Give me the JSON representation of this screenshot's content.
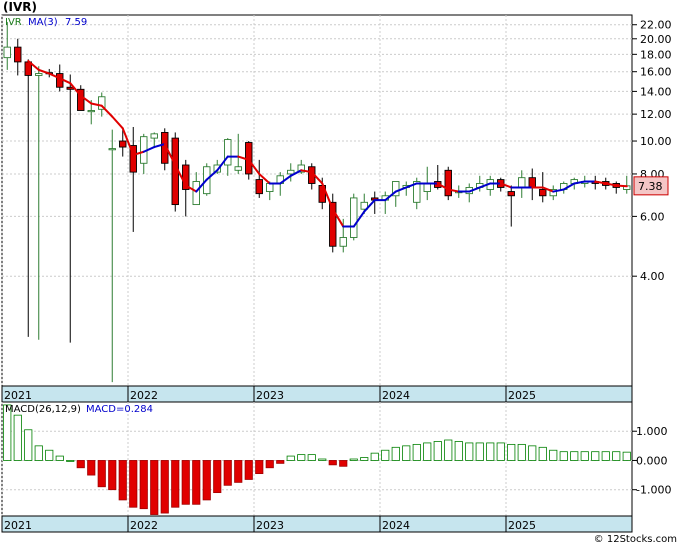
{
  "title": "(IVR)",
  "footer": "© 12Stocks.com",
  "colors": {
    "up": "#2e7d32",
    "down": "#e00000",
    "ma": "#e00000",
    "ma_up": "#0000cc",
    "axis_band": "#c6e5ee",
    "grid": "#cccccc",
    "macd": "#008000"
  },
  "chart_data": [
    {
      "type": "candlestick",
      "legend": {
        "symbol": "IVR",
        "ma_label": "MA(3)",
        "ma_value": "7.59"
      },
      "last_price": "7.38",
      "y_scale": "log",
      "ylim": [
        1.9,
        23.5
      ],
      "y_ticks": [
        "22.00",
        "20.00",
        "18.00",
        "16.00",
        "14.00",
        "12.00",
        "10.00",
        "8.00",
        "6.00",
        "4.00"
      ],
      "x_labels": [
        "2021",
        "2022",
        "2023",
        "2024",
        "2025"
      ],
      "months": [
        "2021-01",
        "2021-02",
        "2021-03",
        "2021-04",
        "2021-05",
        "2021-06",
        "2021-07",
        "2021-08",
        "2021-09",
        "2021-10",
        "2021-11",
        "2021-12",
        "2022-01",
        "2022-02",
        "2022-03",
        "2022-04",
        "2022-05",
        "2022-06",
        "2022-07",
        "2022-08",
        "2022-09",
        "2022-10",
        "2022-11",
        "2022-12",
        "2023-01",
        "2023-02",
        "2023-03",
        "2023-04",
        "2023-05",
        "2023-06",
        "2023-07",
        "2023-08",
        "2023-09",
        "2023-10",
        "2023-11",
        "2023-12",
        "2024-01",
        "2024-02",
        "2024-03",
        "2024-04",
        "2024-05",
        "2024-06",
        "2024-07",
        "2024-08",
        "2024-09",
        "2024-10",
        "2024-11",
        "2024-12",
        "2025-01",
        "2025-02",
        "2025-03",
        "2025-04",
        "2025-05",
        "2025-06",
        "2025-07",
        "2025-08",
        "2025-09",
        "2025-10",
        "2025-11",
        "2025-12"
      ],
      "open": [
        17.6,
        18.9,
        17.1,
        15.6,
        15.9,
        15.8,
        14.4,
        14.2,
        12.3,
        12.4,
        9.5,
        10.0,
        9.7,
        8.6,
        10.2,
        10.6,
        10.2,
        8.5,
        6.5,
        7.0,
        8.1,
        8.5,
        8.2,
        9.9,
        7.7,
        7.1,
        7.5,
        8.0,
        8.1,
        8.4,
        7.4,
        6.6,
        4.9,
        5.2,
        6.3,
        6.8,
        6.7,
        6.9,
        7.3,
        6.6,
        7.1,
        7.6,
        8.2,
        7.1,
        7.0,
        7.3,
        7.2,
        7.7,
        7.1,
        7.3,
        7.8,
        7.2,
        6.9,
        7.2,
        7.5,
        7.5,
        7.6,
        7.6,
        7.5,
        7.2
      ],
      "close": [
        18.9,
        17.1,
        15.6,
        15.8,
        15.8,
        14.4,
        14.2,
        12.3,
        12.3,
        13.5,
        9.5,
        9.6,
        8.1,
        10.3,
        10.5,
        8.6,
        6.5,
        7.2,
        7.6,
        8.4,
        8.5,
        10.1,
        8.4,
        8.0,
        7.0,
        7.5,
        7.9,
        8.2,
        8.5,
        7.5,
        6.6,
        4.9,
        5.2,
        6.8,
        6.6,
        6.7,
        6.9,
        7.6,
        7.4,
        7.6,
        7.5,
        7.3,
        6.9,
        7.1,
        7.3,
        7.5,
        7.7,
        7.3,
        6.9,
        7.8,
        7.3,
        6.9,
        7.2,
        7.5,
        7.7,
        7.6,
        7.5,
        7.4,
        7.3,
        7.38
      ],
      "high": [
        22.4,
        20.0,
        17.4,
        16.6,
        16.3,
        16.8,
        15.7,
        14.6,
        13.2,
        13.9,
        10.8,
        10.8,
        11.0,
        10.5,
        10.6,
        10.9,
        10.6,
        8.8,
        8.1,
        8.6,
        8.8,
        10.2,
        10.5,
        10.0,
        8.8,
        7.6,
        8.1,
        8.6,
        8.8,
        8.6,
        7.8,
        7.0,
        5.9,
        7.0,
        7.0,
        7.1,
        7.1,
        7.6,
        7.6,
        7.8,
        8.4,
        8.5,
        8.4,
        7.4,
        7.5,
        7.9,
        7.9,
        7.8,
        7.4,
        8.2,
        8.3,
        8.1,
        7.4,
        7.6,
        7.8,
        7.9,
        7.9,
        7.8,
        7.6,
        7.9
      ],
      "low": [
        16.2,
        15.6,
        2.65,
        2.6,
        15.4,
        14.0,
        2.55,
        13.3,
        11.2,
        11.8,
        1.95,
        9.0,
        5.4,
        8.0,
        9.6,
        8.2,
        6.2,
        6.0,
        7.1,
        6.9,
        8.0,
        7.9,
        8.0,
        7.7,
        6.8,
        6.7,
        6.9,
        7.6,
        8.0,
        7.2,
        6.3,
        4.7,
        4.7,
        5.1,
        6.1,
        6.1,
        6.1,
        6.4,
        6.9,
        6.3,
        6.7,
        7.2,
        6.7,
        6.8,
        6.6,
        7.1,
        6.9,
        7.1,
        5.6,
        6.8,
        6.7,
        6.6,
        6.7,
        7.0,
        7.2,
        7.3,
        7.2,
        7.2,
        7.0,
        7.0
      ],
      "ma": [
        null,
        null,
        17.2,
        16.2,
        15.8,
        15.3,
        14.8,
        13.6,
        12.9,
        12.7,
        11.8,
        10.9,
        9.1,
        9.3,
        9.6,
        9.8,
        8.5,
        7.4,
        7.1,
        7.7,
        8.2,
        9.0,
        9.0,
        8.8,
        8.0,
        7.5,
        7.5,
        7.9,
        8.2,
        8.1,
        7.5,
        6.3,
        5.6,
        5.6,
        6.2,
        6.7,
        6.7,
        7.1,
        7.3,
        7.5,
        7.5,
        7.5,
        7.2,
        7.1,
        7.1,
        7.3,
        7.5,
        7.5,
        7.3,
        7.3,
        7.3,
        7.3,
        7.1,
        7.2,
        7.5,
        7.6,
        7.6,
        7.5,
        7.4,
        7.36
      ],
      "ma_trend": [
        "up",
        "up",
        "down",
        "down",
        "down",
        "down",
        "down",
        "down",
        "down",
        "down",
        "down",
        "down",
        "down",
        "down",
        "up",
        "up",
        "down",
        "down",
        "down",
        "up",
        "up",
        "up",
        "up",
        "down",
        "down",
        "down",
        "up",
        "up",
        "up",
        "down",
        "down",
        "down",
        "down",
        "up",
        "up",
        "up",
        "up",
        "up",
        "up",
        "up",
        "up",
        "up",
        "down",
        "down",
        "up",
        "up",
        "up",
        "up",
        "down",
        "up",
        "up",
        "down",
        "down",
        "up",
        "up",
        "up",
        "up",
        "down",
        "down",
        "down"
      ]
    },
    {
      "type": "bar",
      "legend": {
        "label": "MACD(26,12,9)",
        "value_label": "MACD=0.284"
      },
      "ylim": [
        -1.9,
        2.0
      ],
      "y_ticks": [
        "1.000",
        "0.000",
        "-1.000"
      ],
      "x_labels": [
        "2021",
        "2022",
        "2023",
        "2024",
        "2025"
      ],
      "values": [
        1.9,
        1.55,
        1.05,
        0.5,
        0.35,
        0.15,
        0.0,
        -0.25,
        -0.5,
        -0.9,
        -1.0,
        -1.35,
        -1.6,
        -1.65,
        -1.85,
        -1.8,
        -1.6,
        -1.5,
        -1.5,
        -1.35,
        -1.1,
        -0.85,
        -0.75,
        -0.65,
        -0.45,
        -0.25,
        -0.1,
        0.15,
        0.2,
        0.2,
        0.05,
        -0.15,
        -0.2,
        0.05,
        0.1,
        0.25,
        0.35,
        0.45,
        0.5,
        0.55,
        0.6,
        0.65,
        0.7,
        0.65,
        0.6,
        0.6,
        0.6,
        0.6,
        0.55,
        0.55,
        0.5,
        0.45,
        0.35,
        0.3,
        0.3,
        0.3,
        0.3,
        0.3,
        0.3,
        0.284
      ]
    }
  ]
}
